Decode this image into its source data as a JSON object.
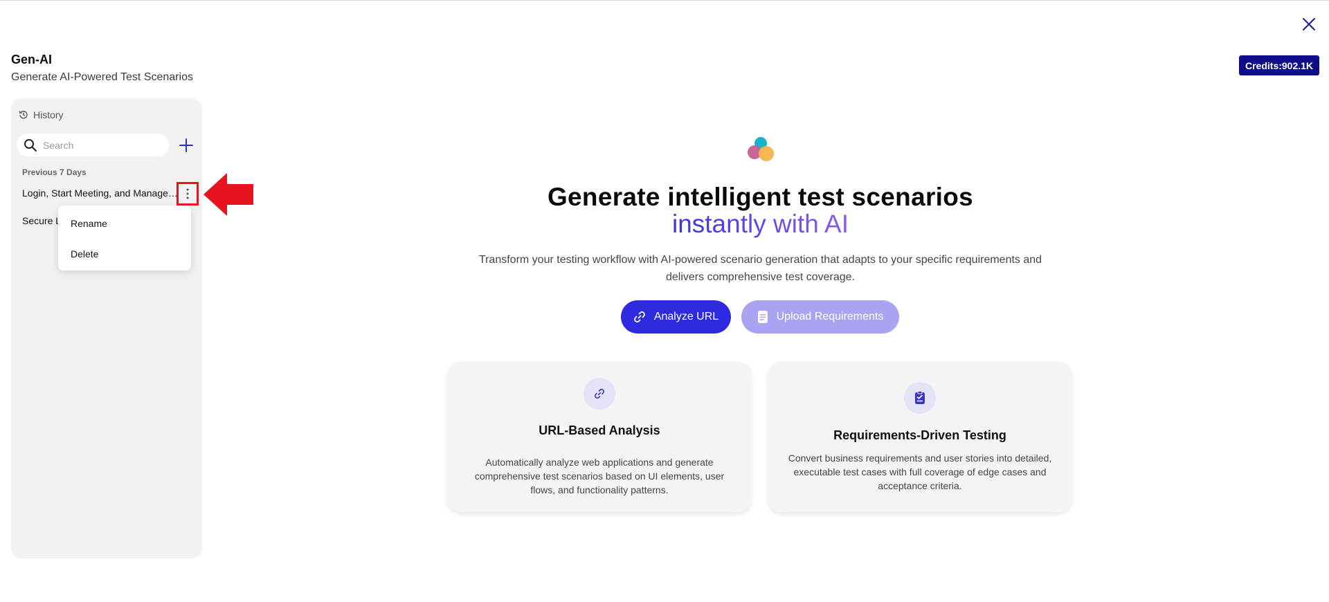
{
  "app": {
    "title": "Gen-AI",
    "subtitle": "Generate AI-Powered Test Scenarios",
    "credits": "Credits:902.1K"
  },
  "sidebar": {
    "history_label": "History",
    "search_placeholder": "Search",
    "group_label": "Previous 7 Days",
    "items": [
      {
        "label": "Login, Start Meeting, and Manage Participants"
      },
      {
        "label": "Secure Login"
      }
    ]
  },
  "context_menu": {
    "rename_label": "Rename",
    "delete_label": "Delete"
  },
  "hero": {
    "title_line1": "Generate intelligent test scenarios",
    "title_line2": "instantly with AI",
    "description": "Transform your testing workflow with AI-powered scenario generation that adapts to your specific requirements and delivers comprehensive test coverage."
  },
  "actions": {
    "analyze_url_label": "Analyze URL",
    "upload_requirements_label": "Upload Requirements"
  },
  "cards": [
    {
      "title": "URL-Based Analysis",
      "description": "Automatically analyze web applications and generate comprehensive test scenarios based on UI elements, user flows, and functionality patterns.",
      "icon": "link-icon"
    },
    {
      "title": "Requirements-Driven Testing",
      "description": "Convert business requirements and user stories into detailed, executable test cases with full coverage of edge cases and acceptance criteria.",
      "icon": "clipboard-check-icon"
    }
  ],
  "colors": {
    "primary": "#2d2ae0",
    "primary_light": "#a9a3f2",
    "credits_bg": "#0e0e8a",
    "highlight_red": "#e8131f",
    "accent_purple": "#6a3fe6"
  }
}
